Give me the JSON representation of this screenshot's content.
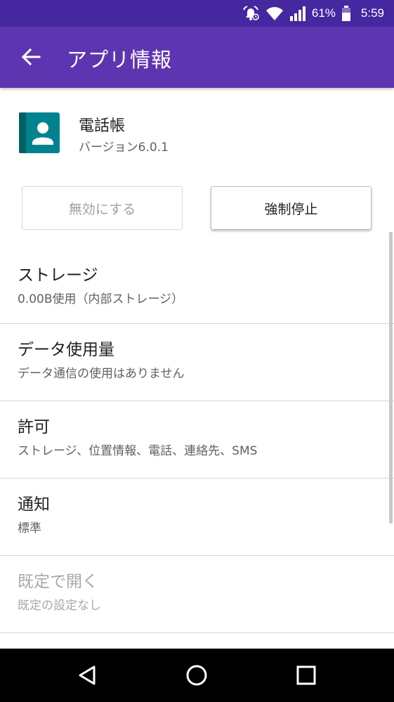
{
  "status_bar": {
    "battery_percent": "61%",
    "time": "5:59",
    "icons": [
      "alarm-icon",
      "wifi-icon",
      "signal-icon",
      "battery-icon"
    ]
  },
  "app_bar": {
    "title": "アプリ情報",
    "back_icon": "arrow-back-icon",
    "background": "#5e35b1",
    "status_background": "#4527a0"
  },
  "app": {
    "name": "電話帳",
    "version": "バージョン6.0.1",
    "icon": "contacts-icon",
    "icon_color": "#00838f"
  },
  "buttons": {
    "disable": "無効にする",
    "force_stop": "強制停止"
  },
  "items": [
    {
      "title": "ストレージ",
      "subtitle": "0.00B使用（内部ストレージ）"
    },
    {
      "title": "データ使用量",
      "subtitle": "データ通信の使用はありません"
    },
    {
      "title": "許可",
      "subtitle": "ストレージ、位置情報、電話、連絡先、SMS"
    },
    {
      "title": "通知",
      "subtitle": "標準"
    },
    {
      "title": "既定で開く",
      "subtitle": "既定の設定なし"
    }
  ],
  "nav_bar": {
    "icons": [
      "back-triangle-icon",
      "home-circle-icon",
      "recents-square-icon"
    ]
  }
}
